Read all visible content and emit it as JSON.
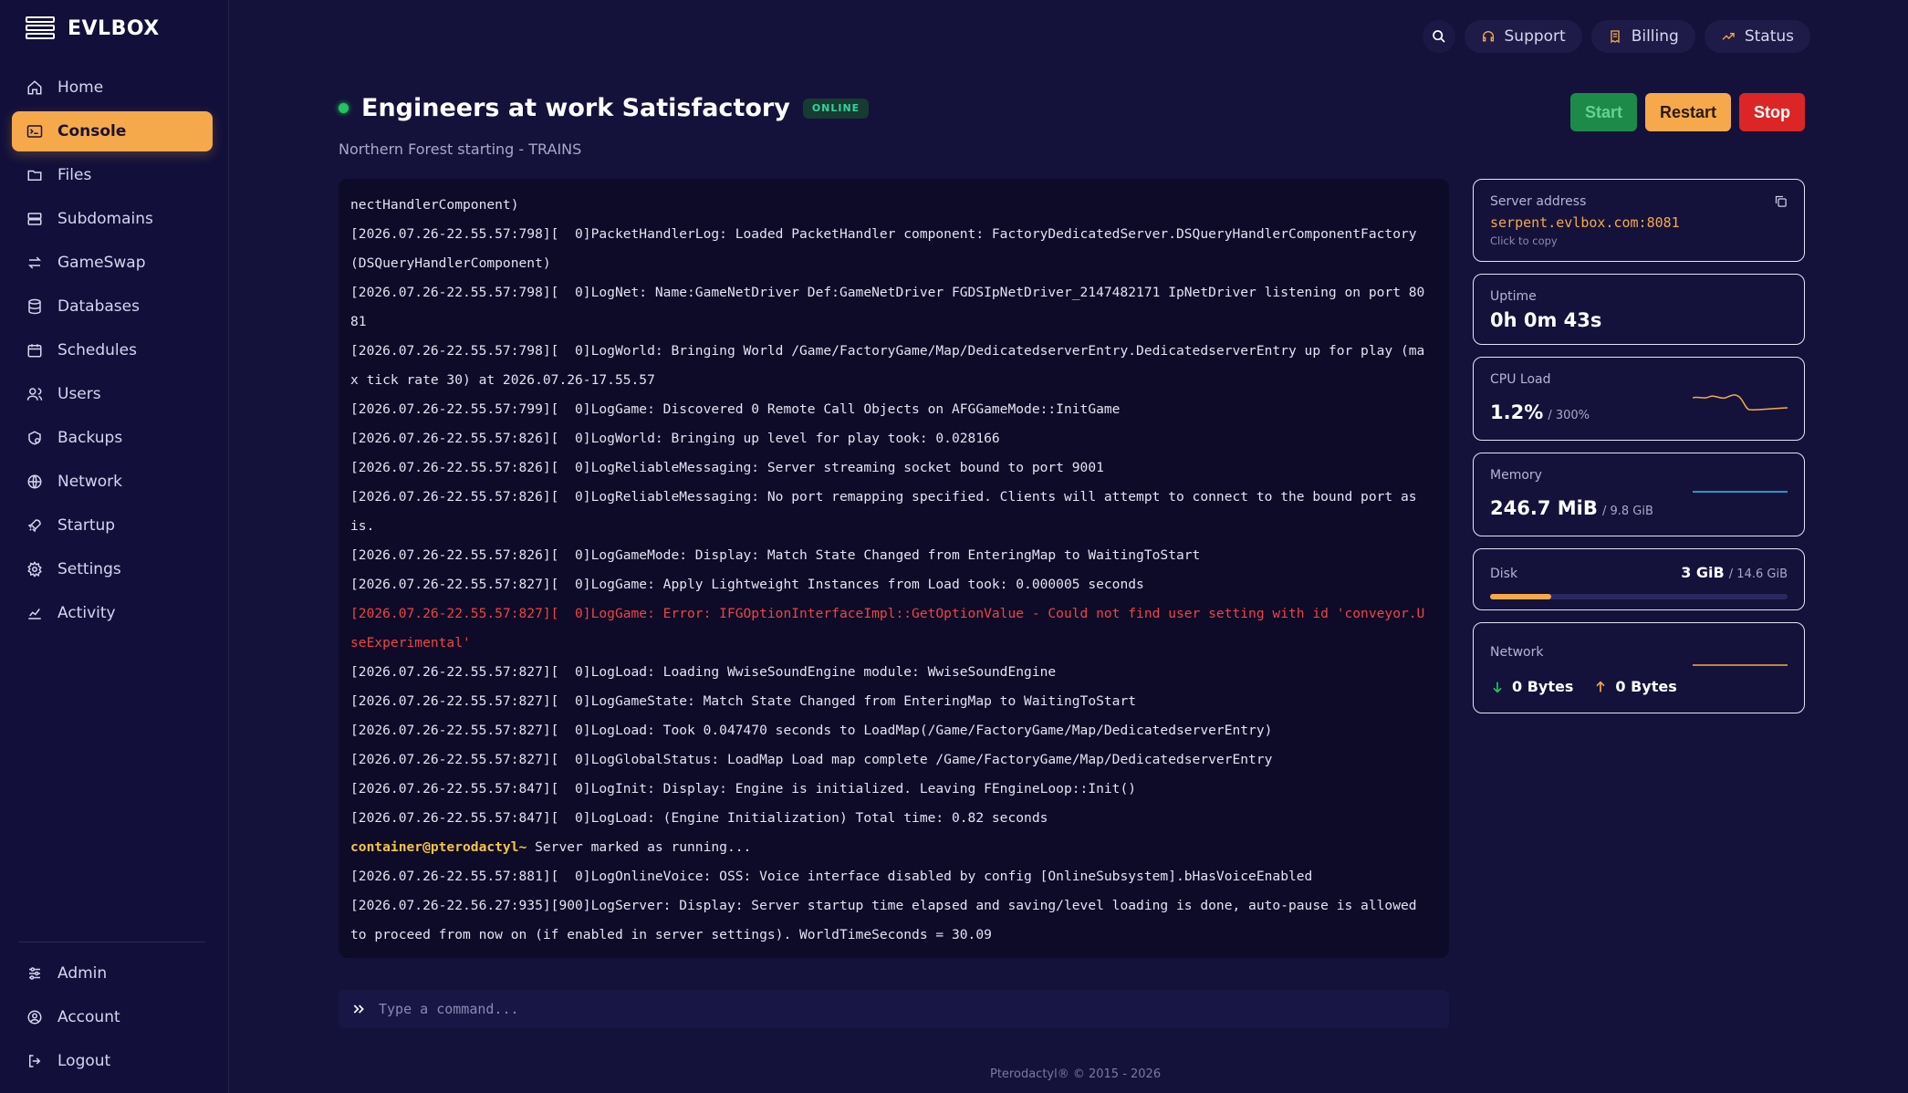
{
  "brand": {
    "name": "EVLBOX"
  },
  "sidebar": {
    "items": [
      {
        "label": "Home",
        "icon": "home-icon"
      },
      {
        "label": "Console",
        "icon": "console-icon",
        "active": true
      },
      {
        "label": "Files",
        "icon": "folder-icon"
      },
      {
        "label": "Subdomains",
        "icon": "subdomains-icon"
      },
      {
        "label": "GameSwap",
        "icon": "swap-icon"
      },
      {
        "label": "Databases",
        "icon": "database-icon"
      },
      {
        "label": "Schedules",
        "icon": "calendar-icon"
      },
      {
        "label": "Users",
        "icon": "users-icon"
      },
      {
        "label": "Backups",
        "icon": "backup-icon"
      },
      {
        "label": "Network",
        "icon": "globe-icon"
      },
      {
        "label": "Startup",
        "icon": "rocket-icon"
      },
      {
        "label": "Settings",
        "icon": "gear-icon"
      },
      {
        "label": "Activity",
        "icon": "activity-icon"
      }
    ],
    "bottom": [
      {
        "label": "Admin",
        "icon": "sliders-icon"
      },
      {
        "label": "Account",
        "icon": "account-icon"
      },
      {
        "label": "Logout",
        "icon": "logout-icon"
      }
    ]
  },
  "topbar": {
    "support": "Support",
    "billing": "Billing",
    "status": "Status"
  },
  "server": {
    "name": "Engineers at work Satisfactory",
    "status_badge": "ONLINE",
    "description": "Northern Forest starting - TRAINS"
  },
  "power": {
    "start": "Start",
    "restart": "Restart",
    "stop": "Stop"
  },
  "console": {
    "lines": [
      "nectHandlerComponent)",
      "[2026.07.26-22.55.57:798][  0]PacketHandlerLog: Loaded PacketHandler component: FactoryDedicatedServer.DSQueryHandlerComponentFactory (DSQueryHandlerComponent)",
      "[2026.07.26-22.55.57:798][  0]LogNet: Name:GameNetDriver Def:GameNetDriver FGDSIpNetDriver_2147482171 IpNetDriver listening on port 8081",
      "[2026.07.26-22.55.57:798][  0]LogWorld: Bringing World /Game/FactoryGame/Map/DedicatedserverEntry.DedicatedserverEntry up for play (max tick rate 30) at 2026.07.26-17.55.57",
      "[2026.07.26-22.55.57:799][  0]LogGame: Discovered 0 Remote Call Objects on AFGGameMode::InitGame",
      "[2026.07.26-22.55.57:826][  0]LogWorld: Bringing up level for play took: 0.028166",
      "[2026.07.26-22.55.57:826][  0]LogReliableMessaging: Server streaming socket bound to port 9001",
      "[2026.07.26-22.55.57:826][  0]LogReliableMessaging: No port remapping specified. Clients will attempt to connect to the bound port as is.",
      "[2026.07.26-22.55.57:826][  0]LogGameMode: Display: Match State Changed from EnteringMap to WaitingToStart",
      "[2026.07.26-22.55.57:827][  0]LogGame: Apply Lightweight Instances from Load took: 0.000005 seconds",
      "[2026.07.26-22.55.57:827][  0]LogGame: Error: IFGOptionInterfaceImpl::GetOptionValue - Could not find user setting with id 'conveyor.UseExperimental'",
      "[2026.07.26-22.55.57:827][  0]LogLoad: Loading WwiseSoundEngine module: WwiseSoundEngine",
      "[2026.07.26-22.55.57:827][  0]LogGameState: Match State Changed from EnteringMap to WaitingToStart",
      "[2026.07.26-22.55.57:827][  0]LogLoad: Took 0.047470 seconds to LoadMap(/Game/FactoryGame/Map/DedicatedserverEntry)",
      "[2026.07.26-22.55.57:827][  0]LogGlobalStatus: LoadMap Load map complete /Game/FactoryGame/Map/DedicatedserverEntry",
      "[2026.07.26-22.55.57:847][  0]LogInit: Display: Engine is initialized. Leaving FEngineLoop::Init()",
      "[2026.07.26-22.55.57:847][  0]LogLoad: (Engine Initialization) Total time: 0.82 seconds",
      "PROMPT",
      "[2026.07.26-22.55.57:881][  0]LogOnlineVoice: OSS: Voice interface disabled by config [OnlineSubsystem].bHasVoiceEnabled",
      "[2026.07.26-22.56.27:935][900]LogServer: Display: Server startup time elapsed and saving/level loading is done, auto-pause is allowed to proceed from now on (if enabled in server settings). WorldTimeSeconds = 30.09"
    ],
    "error_line_index": 10,
    "prompt_user": "container@pterodactyl~",
    "prompt_text": " Server marked as running...",
    "input_placeholder": "Type a command..."
  },
  "stats": {
    "address": {
      "label": "Server address",
      "value": "serpent.evlbox.com:8081",
      "hint": "Click to copy"
    },
    "uptime": {
      "label": "Uptime",
      "value": "0h 0m 43s"
    },
    "cpu": {
      "label": "CPU Load",
      "value": "1.2%",
      "limit": "/ 300%"
    },
    "memory": {
      "label": "Memory",
      "value": "246.7 MiB",
      "limit": "/ 9.8 GiB"
    },
    "disk": {
      "label": "Disk",
      "value": "3 GiB",
      "limit": "/ 14.6 GiB",
      "fraction": 0.205
    },
    "network": {
      "label": "Network",
      "down": "0 Bytes",
      "up": "0 Bytes"
    }
  },
  "colors": {
    "accent": "#f6a94b",
    "online": "#22c55e",
    "error": "#ef4444",
    "start": "#1e8a4a",
    "stop": "#dc2626"
  },
  "footer": {
    "text": "Pterodactyl® © 2015 - 2026"
  }
}
